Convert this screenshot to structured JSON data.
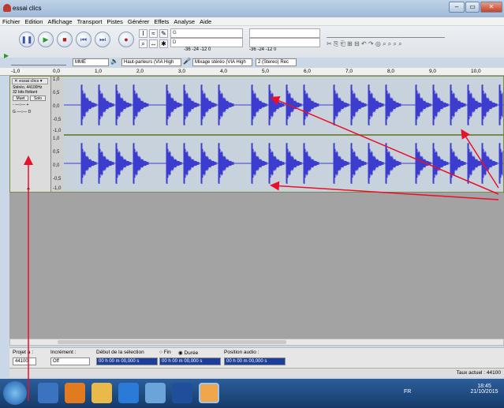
{
  "window": {
    "title": "essai clics",
    "minimize": "–",
    "maximize": "▭",
    "close": "✕"
  },
  "menu": [
    "Fichier",
    "Edition",
    "Affichage",
    "Transport",
    "Pistes",
    "Générer",
    "Effets",
    "Analyse",
    "Aide"
  ],
  "transport": {
    "pause": "pause-icon",
    "play": "play-icon",
    "stop": "stop-icon",
    "skip_start": "skip-start-icon",
    "skip_end": "skip-end-icon",
    "record": "record-icon"
  },
  "meters": {
    "playback_scale": "-36 -24 -12 0",
    "record_scale": "-36 -24 -12 0",
    "L": "G",
    "R": "D"
  },
  "devices": {
    "host": "MME",
    "output": "Haut-parleurs (VIA High",
    "input": "Mixage stéréo (VIA High",
    "channels": "2 (Stereo) Rec"
  },
  "ruler": [
    "-1,0",
    "0,0",
    "1,0",
    "2,0",
    "3,0",
    "4,0",
    "5,0",
    "6,0",
    "7,0",
    "8,0",
    "9,0",
    "10,0"
  ],
  "track": {
    "name": "essai clics",
    "info1": "Stéréo, 44100Hz",
    "info2": "32 bits flottant",
    "mute": "Muet",
    "solo": "Solo",
    "gain_left": "-",
    "gain_right": "+",
    "pan_left": "G",
    "pan_right": "D"
  },
  "scale": [
    "1,0",
    "0,5",
    "0,0",
    "-0,5",
    "-1,0",
    "1,0",
    "0,5",
    "0,0",
    "-0,5",
    "-1,0"
  ],
  "selection": {
    "project_label": "Projet à :",
    "rate": "44100",
    "snap_label": "Incrément :",
    "snap_value": "Off",
    "start_label": "Début de la sélection",
    "end_option": "Fin",
    "length_option": "Durée",
    "position_label": "Position audio :",
    "start_value": "00 h 00 m 00,000 s",
    "end_value": "00 h 00 m 00,000 s",
    "position_value": "00 h 00 m 00,000 s"
  },
  "status": {
    "rate": "Taux actuel : 44100"
  },
  "taskbar": {
    "lang": "FR",
    "time": "18:45",
    "date": "21/10/2015"
  },
  "colors": {
    "wave": "#3c3ccf",
    "wave_bg": "#c8d2dd",
    "annotation": "#e8102a"
  }
}
